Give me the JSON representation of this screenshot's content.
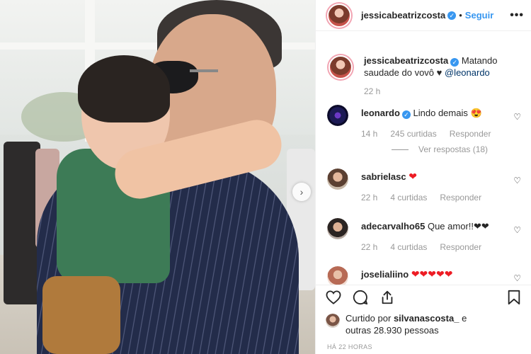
{
  "post": {
    "author": "jessicabeatrizcosta",
    "follow_label": "Seguir",
    "dot": "•",
    "more_label": "•••"
  },
  "caption": {
    "username": "jessicabeatrizcosta",
    "text": "Matando saudade do vovô ♥",
    "mention": "@leonardo",
    "time": "22 h"
  },
  "comments": [
    {
      "username": "leonardo",
      "verified": true,
      "text": "Lindo demais 😍",
      "time": "14 h",
      "likes": "245 curtidas",
      "reply": "Responder",
      "view_replies": "Ver respostas (18)"
    },
    {
      "username": "sabrielasc",
      "verified": false,
      "text": "❤",
      "time": "22 h",
      "likes": "4 curtidas",
      "reply": "Responder"
    },
    {
      "username": "adecarvalho65",
      "verified": false,
      "text": "Que amor!!❤❤",
      "time": "22 h",
      "likes": "4 curtidas",
      "reply": "Responder"
    },
    {
      "username": "joselialiino",
      "verified": false,
      "text": "❤❤❤❤❤",
      "time": "",
      "likes": "",
      "reply": ""
    }
  ],
  "footer": {
    "liked_by_prefix": "Curtido por",
    "liked_by_user": "silvanascosta_",
    "liked_by_suffix": "e",
    "others_prefix": "outras",
    "others_count": "28.930",
    "others_suffix": "pessoas",
    "time_ago": "HÁ 22 HORAS"
  },
  "icons": {
    "like": "heart-icon",
    "comment": "comment-icon",
    "share": "share-icon",
    "save": "bookmark-icon",
    "verified": "verified-badge-icon"
  },
  "colors": {
    "link_blue": "#3897f0",
    "verified_blue": "#3897f0",
    "meta_gray": "#999999",
    "text": "#262626"
  }
}
